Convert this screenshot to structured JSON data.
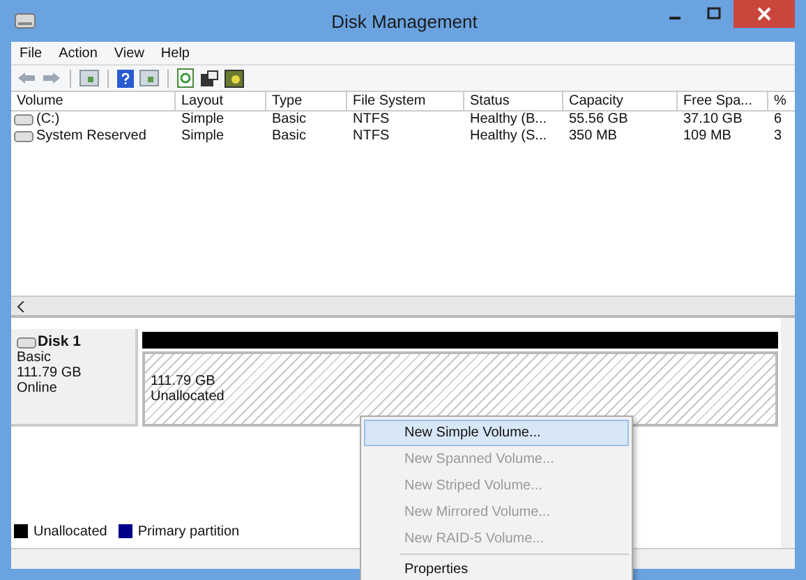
{
  "window": {
    "title": "Disk Management"
  },
  "menu": [
    "File",
    "Action",
    "View",
    "Help"
  ],
  "table": {
    "columns": [
      "Volume",
      "Layout",
      "Type",
      "File System",
      "Status",
      "Capacity",
      "Free Spa...",
      "%"
    ],
    "rows": [
      {
        "cells": [
          "(C:)",
          "Simple",
          "Basic",
          "NTFS",
          "Healthy (B...",
          "55.56 GB",
          "37.10 GB",
          "6"
        ]
      },
      {
        "cells": [
          "System Reserved",
          "Simple",
          "Basic",
          "NTFS",
          "Healthy (S...",
          "350 MB",
          "109 MB",
          "3"
        ]
      }
    ]
  },
  "disk": {
    "name": "Disk 1",
    "type": "Basic",
    "size": "111.79 GB",
    "state": "Online",
    "partition": {
      "size": "111.79 GB",
      "label": "Unallocated"
    }
  },
  "legend": [
    {
      "label": "Unallocated",
      "color": "#000000"
    },
    {
      "label": "Primary partition",
      "color": "#00008b"
    }
  ],
  "context_menu": [
    {
      "label": "New Simple Volume...",
      "disabled": false,
      "selected": true
    },
    {
      "label": "New Spanned Volume...",
      "disabled": true,
      "selected": false
    },
    {
      "label": "New Striped Volume...",
      "disabled": true,
      "selected": false
    },
    {
      "label": "New Mirrored Volume...",
      "disabled": true,
      "selected": false
    },
    {
      "label": "New RAID-5 Volume...",
      "disabled": true,
      "selected": false
    },
    {
      "label": "Properties",
      "disabled": false,
      "selected": false
    }
  ]
}
